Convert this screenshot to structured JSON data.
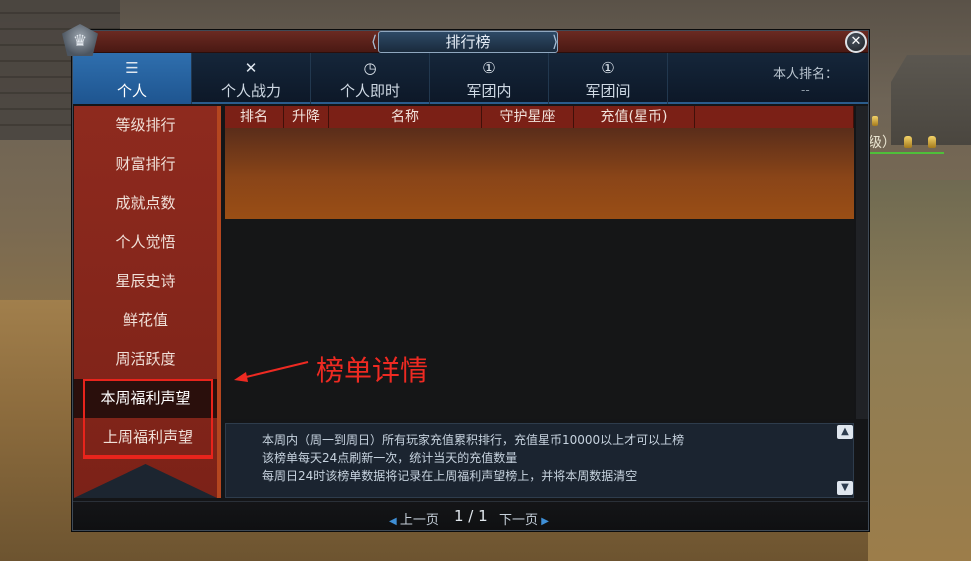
{
  "window": {
    "title": "排行榜",
    "close_icon": "close-icon"
  },
  "tabs": [
    {
      "label": "个人",
      "icon": "list-icon",
      "active": true
    },
    {
      "label": "个人战力",
      "icon": "swords-icon",
      "active": false
    },
    {
      "label": "个人即时",
      "icon": "clock-icon",
      "active": false
    },
    {
      "label": "军团内",
      "icon": "legion-icon",
      "active": false
    },
    {
      "label": "军团间",
      "icon": "legion-versus-icon",
      "active": false
    }
  ],
  "my_rank": {
    "label": "本人排名：",
    "value": "--"
  },
  "sidebar": {
    "items": [
      {
        "label": "等级排行"
      },
      {
        "label": "财富排行"
      },
      {
        "label": "成就点数"
      },
      {
        "label": "个人觉悟"
      },
      {
        "label": "星辰史诗"
      },
      {
        "label": "鲜花值"
      },
      {
        "label": "周活跃度"
      },
      {
        "label": "本周福利声望"
      },
      {
        "label": "上周福利声望"
      }
    ]
  },
  "table": {
    "columns": [
      "排名",
      "升降",
      "名称",
      "守护星座",
      "充值(星币)"
    ]
  },
  "description": {
    "lines": [
      "本周内（周一到周日）所有玩家充值累积排行，充值星币10000以上才可以上榜",
      "该榜单每天24点刷新一次，统计当天的充值数量",
      "每周日24时该榜单数据将记录在上周福利声望榜上，并将本周数据清空"
    ]
  },
  "pager": {
    "prev": "上一页",
    "page": "1 / 1",
    "next": "下一页"
  },
  "annotation": {
    "text": "榜单详情",
    "color": "#ee2a22"
  },
  "world": {
    "label": "级）"
  },
  "colors": {
    "accent": "#2f6fae",
    "sidebar": "#8e2a1e",
    "header": "#7b2016"
  }
}
